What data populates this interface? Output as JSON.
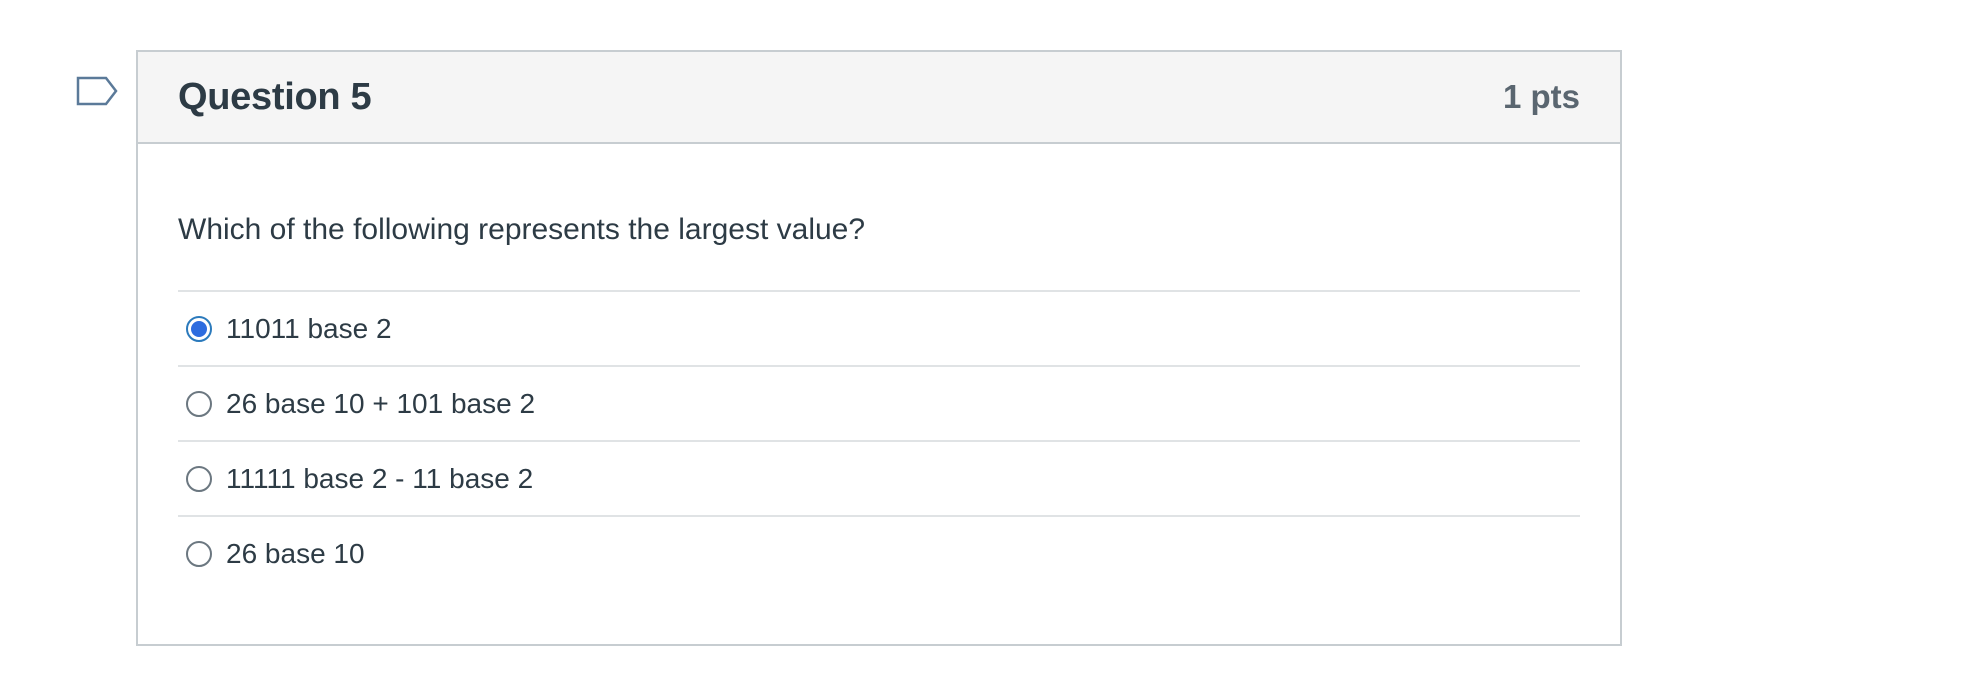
{
  "question": {
    "title": "Question 5",
    "points": "1 pts",
    "text": "Which of the following represents the largest value?",
    "flag_icon": "flag-outline-icon"
  },
  "answers": [
    {
      "label": "11011 base 2",
      "selected": true
    },
    {
      "label": "26 base 10 + 101 base 2",
      "selected": false
    },
    {
      "label": "11111 base 2 - 11 base 2",
      "selected": false
    },
    {
      "label": "26 base 10",
      "selected": false
    }
  ],
  "colors": {
    "accent": "#2d6cdf",
    "text": "#2d3b45",
    "header_bg": "#f5f5f5",
    "border": "#c7cdd1"
  }
}
